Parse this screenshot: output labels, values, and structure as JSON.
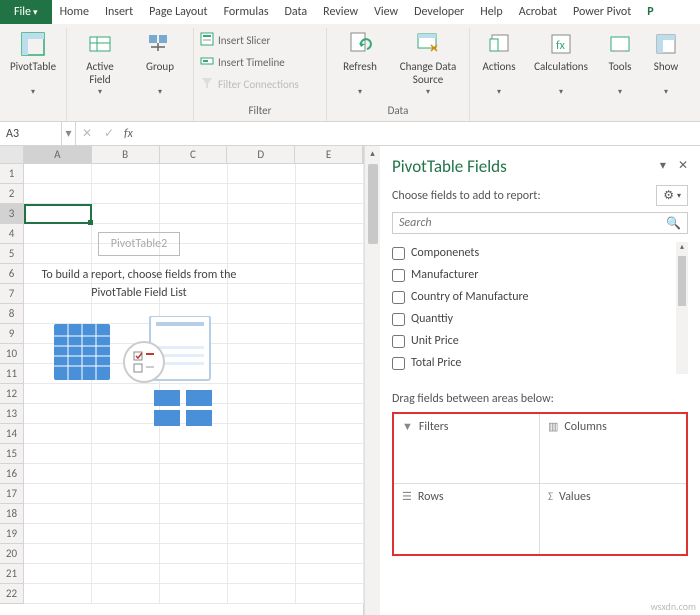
{
  "tabs": {
    "file": "File",
    "items": [
      "Home",
      "Insert",
      "Page Layout",
      "Formulas",
      "Data",
      "Review",
      "View",
      "Developer",
      "Help",
      "Acrobat",
      "Power Pivot"
    ],
    "overflow": "P"
  },
  "ribbon": {
    "g1": {
      "pivot": "PivotTable"
    },
    "g2": {
      "active": "Active\nField",
      "group": "Group"
    },
    "filter": {
      "slicer": "Insert Slicer",
      "timeline": "Insert Timeline",
      "connections": "Filter Connections",
      "label": "Filter"
    },
    "data": {
      "refresh": "Refresh",
      "change": "Change Data\nSource",
      "label": "Data"
    },
    "g5": {
      "actions": "Actions",
      "calc": "Calculations",
      "tools": "Tools",
      "show": "Show"
    }
  },
  "formula": {
    "nameBox": "A3",
    "fx": "fx"
  },
  "sheet": {
    "cols": [
      "A",
      "B",
      "C",
      "D",
      "E"
    ],
    "activeCol": "A",
    "activeRow": 3,
    "rows": 22
  },
  "pivotPlaceholder": {
    "name": "PivotTable2",
    "text": "To build a report, choose fields from the PivotTable Field List"
  },
  "fieldPane": {
    "title": "PivotTable Fields",
    "choose": "Choose fields to add to report:",
    "searchPlaceholder": "Search",
    "fields": [
      "Componenets",
      "Manufacturer",
      "Country of Manufacture",
      "Quanttiy",
      "Unit Price",
      "Total Price"
    ],
    "dragLabel": "Drag fields between areas below:",
    "areas": {
      "filters": "Filters",
      "columns": "Columns",
      "rows": "Rows",
      "values": "Values"
    }
  },
  "watermark": "wsxdn.com"
}
